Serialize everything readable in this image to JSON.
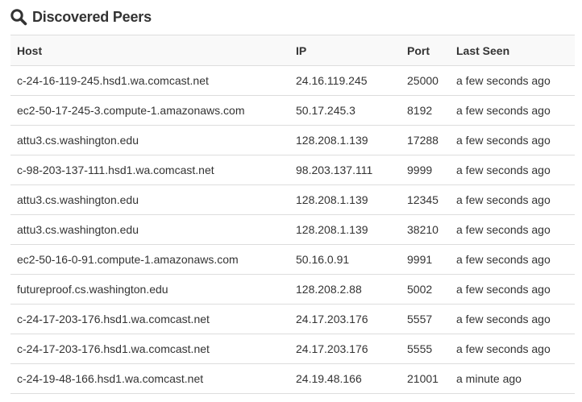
{
  "panel": {
    "title": "Discovered Peers",
    "icon": "search-icon"
  },
  "table": {
    "columns": [
      "Host",
      "IP",
      "Port",
      "Last Seen"
    ],
    "rows": [
      [
        "c-24-16-119-245.hsd1.wa.comcast.net",
        "24.16.119.245",
        "25000",
        "a few seconds ago"
      ],
      [
        "ec2-50-17-245-3.compute-1.amazonaws.com",
        "50.17.245.3",
        "8192",
        "a few seconds ago"
      ],
      [
        "attu3.cs.washington.edu",
        "128.208.1.139",
        "17288",
        "a few seconds ago"
      ],
      [
        "c-98-203-137-111.hsd1.wa.comcast.net",
        "98.203.137.111",
        "9999",
        "a few seconds ago"
      ],
      [
        "attu3.cs.washington.edu",
        "128.208.1.139",
        "12345",
        "a few seconds ago"
      ],
      [
        "attu3.cs.washington.edu",
        "128.208.1.139",
        "38210",
        "a few seconds ago"
      ],
      [
        "ec2-50-16-0-91.compute-1.amazonaws.com",
        "50.16.0.91",
        "9991",
        "a few seconds ago"
      ],
      [
        "futureproof.cs.washington.edu",
        "128.208.2.88",
        "5002",
        "a few seconds ago"
      ],
      [
        "c-24-17-203-176.hsd1.wa.comcast.net",
        "24.17.203.176",
        "5557",
        "a few seconds ago"
      ],
      [
        "c-24-17-203-176.hsd1.wa.comcast.net",
        "24.17.203.176",
        "5555",
        "a few seconds ago"
      ],
      [
        "c-24-19-48-166.hsd1.wa.comcast.net",
        "24.19.48.166",
        "21001",
        "a minute ago"
      ]
    ]
  }
}
